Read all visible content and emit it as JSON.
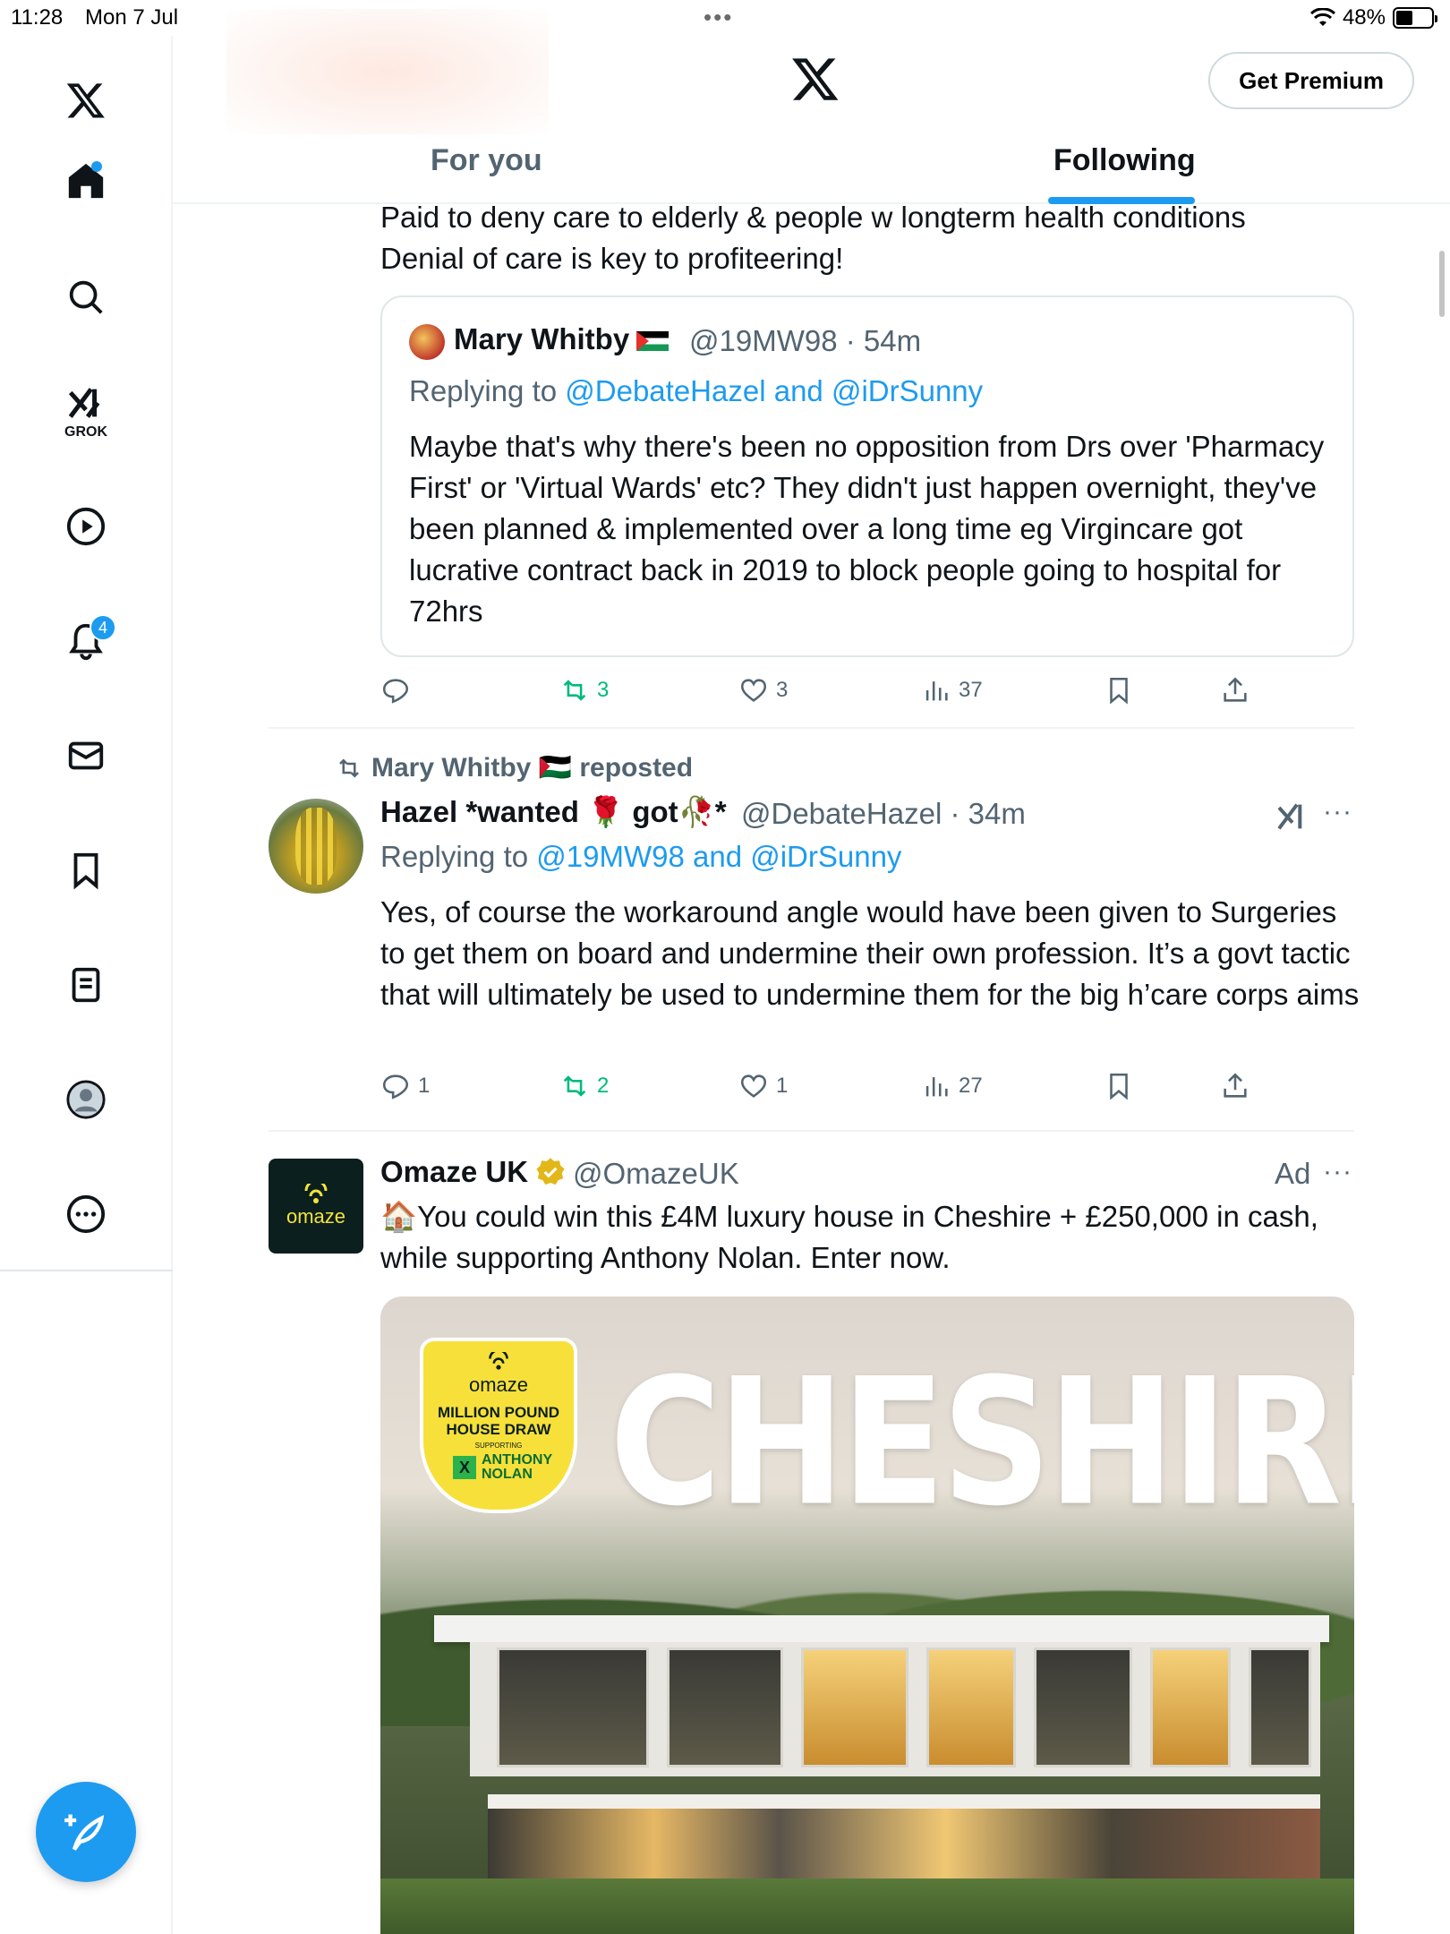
{
  "status_bar": {
    "time": "11:28",
    "date": "Mon 7 Jul",
    "battery": "48%",
    "battery_level": 0.48
  },
  "sidebar": {
    "items": [
      {
        "name": "home",
        "badge": ""
      },
      {
        "name": "explore",
        "badge": ""
      },
      {
        "name": "grok",
        "label": "GROK"
      },
      {
        "name": "video",
        "badge": ""
      },
      {
        "name": "notifications",
        "badge": "4"
      },
      {
        "name": "messages",
        "badge": ""
      },
      {
        "name": "bookmarks",
        "badge": ""
      },
      {
        "name": "lists",
        "badge": ""
      },
      {
        "name": "profile",
        "badge": ""
      },
      {
        "name": "more",
        "badge": ""
      }
    ]
  },
  "header": {
    "premium_label": "Get Premium",
    "tabs": [
      {
        "label": "For you",
        "active": false
      },
      {
        "label": "Following",
        "active": true
      }
    ]
  },
  "post1": {
    "text_line1": "Paid to deny care to elderly & people w longterm health conditions",
    "text_line2": "Denial of care is key to profiteering!",
    "quote": {
      "name": "Mary Whitby",
      "handle": "@19MW98",
      "time": "54m",
      "replying_prefix": "Replying to ",
      "replying_to": "@DebateHazel and @iDrSunny",
      "text": "Maybe that's why there's been no opposition from Drs over 'Pharmacy First' or 'Virtual Wards' etc? They didn't just happen overnight, they've been planned & implemented over a long time eg Virgincare got lucrative contract back in 2019 to block people going to hospital for 72hrs"
    },
    "actions": {
      "replies": "",
      "reposts": "3",
      "likes": "3",
      "views": "37"
    }
  },
  "post2": {
    "repost_by": "Mary Whitby 🇵🇸 reposted",
    "name": "Hazel *wanted 🌹 got🥀*",
    "handle": "@DebateHazel",
    "time": "34m",
    "replying_prefix": "Replying to ",
    "replying_to": "@19MW98 and @iDrSunny",
    "text": "Yes, of course the workaround angle would have been given to Surgeries to get them on board and undermine their own profession. It’s a govt tactic that will ultimately be used to undermine them for the big h’care corps aims",
    "actions": {
      "replies": "1",
      "reposts": "2",
      "likes": "1",
      "views": "27"
    }
  },
  "ad": {
    "name": "Omaze UK",
    "handle": "@OmazeUK",
    "label": "Ad",
    "logo_text": "omaze",
    "text": "🏠You could win this £4M luxury house in Cheshire + £250,000 in cash, while supporting Anthony Nolan. Enter now.",
    "image": {
      "headline": "CHESHIRE",
      "badge_logo": "omaze",
      "badge_title": "MILLION POUND HOUSE DRAW",
      "badge_supporting": "SUPPORTING",
      "badge_charity": "ANTHONY NOLAN"
    }
  },
  "icons": {
    "brand_color": "#1d9bf0",
    "repost_color": "#00ba7c",
    "muted_color": "#536471"
  }
}
